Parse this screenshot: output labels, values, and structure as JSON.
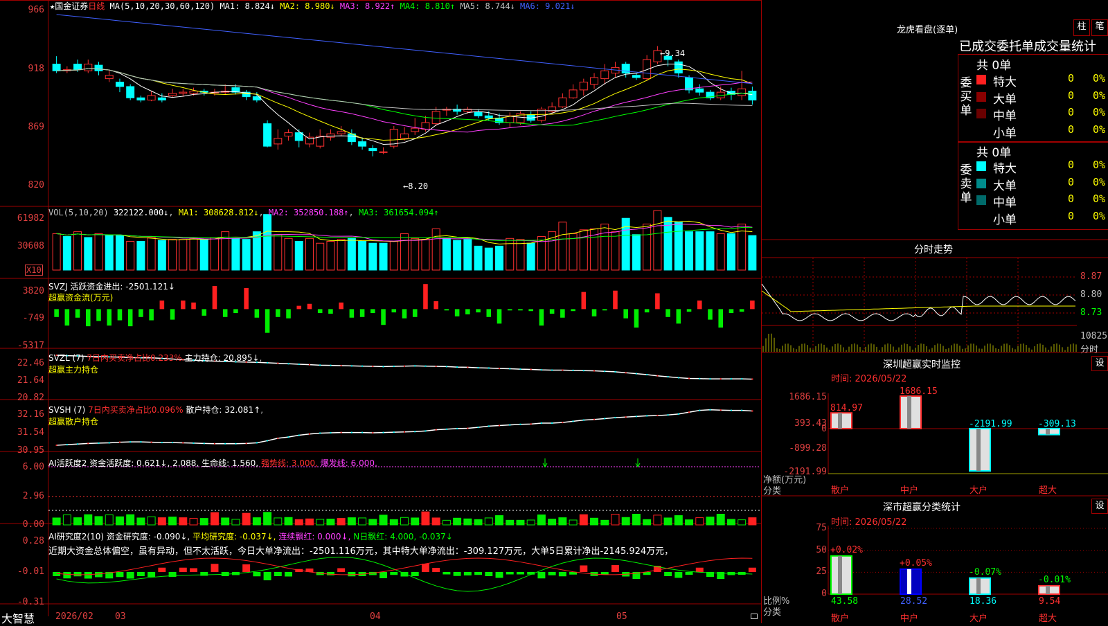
{
  "stock": {
    "star": "★",
    "name": "国金证券",
    "period": "日线",
    "ma_params": "MA(5,10,20,30,60,120)",
    "ma1": "MA1: 8.824↓",
    "ma2": "MA2: 8.980↓",
    "ma3": "MA3: 8.922↑",
    "ma4": "MA4: 8.810↑",
    "ma5": "MA5: 8.744↓",
    "ma6": "MA6: 9.021↓",
    "high_label": "9.34",
    "low_label": "8.20"
  },
  "price_axis": [
    "966",
    "918",
    "869",
    "820"
  ],
  "vol": {
    "params": "VOL(5,10,20)",
    "value": "322122.000↓",
    "ma1": "MA1: 308628.812↓",
    "ma2": "MA2: 352850.188↑",
    "ma3": "MA3: 361654.094↑",
    "axis": [
      "61982",
      "30608"
    ],
    "unit": "X10"
  },
  "svzj": {
    "title": "SVZJ  活跃资金进出: -2501.121↓",
    "subtitle": "超赢资金流(万元)",
    "axis": [
      "3820",
      "-749",
      "-5317"
    ]
  },
  "svzl": {
    "title_a": "SVZL (7)",
    "title_b": "7日内买卖净占比0.233%",
    "title_c": "主力持仓: 20.895↓",
    "subtitle": "超赢主力持仓",
    "axis": [
      "22.46",
      "21.64",
      "20.82"
    ]
  },
  "svsh": {
    "title_a": "SVSH (7)",
    "title_b": "7日内买卖净占比0.096%",
    "title_c": "散户持仓: 32.081↑",
    "subtitle": "超赢散户持仓",
    "axis": [
      "32.16",
      "31.54",
      "30.95"
    ]
  },
  "ai_active": {
    "title_a": "AI活跃度2 资金活跃度: 0.621↓, 2.088, 生命线: 1.560,",
    "title_b": "强势线: 3.000,",
    "title_c": "爆发线: 6.000,",
    "axis": [
      "6.00",
      "2.96",
      "0.00"
    ]
  },
  "ai_research": {
    "title_a": "AI研究度2(10) 资金研究度: -0.090↓,",
    "title_b": "平均研究度: -0.037↓,",
    "title_c": "连续飘红: 0.000↓,",
    "title_d": "N日飘红: 4.000, -0.037↓",
    "comment": "近期大资金总体偏空，虽有异动，但不太活跃，今日大单净流出：-2501.116万元，其中特大单净流出：-309.127万元，大单5日累计净出-2145.924万元，",
    "axis": [
      "0.28",
      "-0.01",
      "-0.31"
    ]
  },
  "xaxis": {
    "brand": "大智慧",
    "labels": [
      "2026/02",
      "03",
      "04",
      "05"
    ]
  },
  "dragon": {
    "title": "龙虎看盘(逐单)",
    "btn_bar": "柱",
    "btn_pen": "笔",
    "header": "已成交委托单成交量统计",
    "buy": {
      "side_label": "委买单",
      "total": "共 0单",
      "rows": [
        {
          "label": "特大",
          "value": "0",
          "pct": "0%"
        },
        {
          "label": "大单",
          "value": "0",
          "pct": "0%"
        },
        {
          "label": "中单",
          "value": "0",
          "pct": "0%"
        },
        {
          "label": "小单",
          "value": "0",
          "pct": "0%"
        }
      ]
    },
    "sell": {
      "side_label": "委卖单",
      "total": "共 0单",
      "rows": [
        {
          "label": "特大",
          "value": "0",
          "pct": "0%"
        },
        {
          "label": "大单",
          "value": "0",
          "pct": "0%"
        },
        {
          "label": "中单",
          "value": "0",
          "pct": "0%"
        },
        {
          "label": "小单",
          "value": "0",
          "pct": "0%"
        }
      ]
    }
  },
  "intraday": {
    "title": "分时走势",
    "axis": [
      "8.87",
      "8.80",
      "8.73"
    ],
    "vol_label": "10825",
    "vol_unit": "分时"
  },
  "sz_monitor": {
    "title": "深圳超赢实时监控",
    "btn": "设",
    "time": "时间: 2026/05/22",
    "axis": [
      "1686.15",
      "393.43",
      "0",
      "-899.28",
      "-2191.99"
    ],
    "ylabel": "净额(万元)",
    "xlabel": "分类",
    "cats": [
      "散户",
      "中户",
      "大户",
      "超大"
    ],
    "values": [
      814.97,
      1686.15,
      -2191.99,
      -309.13
    ],
    "value_labels": [
      "814.97",
      "1686.15",
      "-2191.99",
      "-309.13"
    ]
  },
  "sz_class": {
    "title": "深市超赢分类统计",
    "btn": "设",
    "time": "时间: 2026/05/22",
    "axis": [
      "75",
      "50",
      "25",
      "0"
    ],
    "ylabel": "比例%",
    "xlabel": "分类",
    "cats": [
      "散户",
      "中户",
      "大户",
      "超大"
    ],
    "values": [
      43.58,
      28.52,
      18.36,
      9.54
    ],
    "pct_labels": [
      "+0.02%",
      "+0.05%",
      "-0.07%",
      "-0.01%"
    ],
    "value_labels": [
      "43.58",
      "28.52",
      "18.36",
      "9.54"
    ]
  },
  "colors": {
    "grid": "#a00000",
    "up": "#ff3030",
    "down": "#00ffff",
    "ma1": "#ffffff",
    "ma2": "#ffff00",
    "ma3": "#ff40ff",
    "ma4": "#00ff00",
    "ma5": "#c0c0c0",
    "ma6": "#4060ff"
  },
  "chart_data": [
    {
      "type": "candlestick",
      "title": "国金证券 日线",
      "ylim": [
        8.1,
        9.7
      ],
      "candles": [
        [
          9.18,
          9.12,
          9.25,
          9.1
        ],
        [
          9.12,
          9.13,
          9.16,
          9.1
        ],
        [
          9.18,
          9.13,
          9.22,
          9.11
        ],
        [
          9.12,
          9.18,
          9.22,
          9.1
        ],
        [
          9.17,
          9.12,
          9.2,
          9.08
        ],
        [
          9.05,
          9.08,
          9.12,
          9.02
        ],
        [
          9.02,
          8.98,
          9.05,
          8.93
        ],
        [
          8.98,
          8.88,
          9.0,
          8.86
        ],
        [
          8.88,
          8.86,
          8.9,
          8.84
        ],
        [
          8.86,
          8.9,
          8.94,
          8.85
        ],
        [
          8.88,
          8.86,
          8.92,
          8.84
        ],
        [
          8.9,
          8.92,
          8.96,
          8.88
        ],
        [
          8.92,
          8.93,
          8.96,
          8.89
        ],
        [
          8.92,
          8.94,
          8.97,
          8.9
        ],
        [
          8.94,
          8.93,
          8.96,
          8.9
        ],
        [
          8.93,
          8.93,
          8.96,
          8.9
        ],
        [
          8.93,
          8.94,
          9.0,
          8.91
        ],
        [
          8.97,
          8.93,
          9.0,
          8.91
        ],
        [
          8.93,
          8.89,
          8.95,
          8.86
        ],
        [
          8.89,
          8.86,
          8.93,
          8.84
        ],
        [
          8.65,
          8.45,
          8.68,
          8.44
        ],
        [
          8.47,
          8.52,
          8.6,
          8.42
        ],
        [
          8.54,
          8.57,
          8.6,
          8.5
        ],
        [
          8.57,
          8.5,
          8.6,
          8.44
        ],
        [
          8.47,
          8.53,
          8.57,
          8.44
        ],
        [
          8.45,
          8.54,
          8.6,
          8.43
        ],
        [
          8.53,
          8.56,
          8.6,
          8.5
        ],
        [
          8.56,
          8.58,
          8.63,
          8.54
        ],
        [
          8.56,
          8.49,
          8.6,
          8.46
        ],
        [
          8.49,
          8.45,
          8.52,
          8.42
        ],
        [
          8.43,
          8.41,
          8.46,
          8.36
        ],
        [
          8.4,
          8.4,
          8.44,
          8.38
        ],
        [
          8.45,
          8.6,
          8.63,
          8.43
        ],
        [
          8.52,
          8.56,
          8.62,
          8.5
        ],
        [
          8.58,
          8.61,
          8.7,
          8.55
        ],
        [
          8.6,
          8.66,
          8.72,
          8.58
        ],
        [
          8.65,
          8.76,
          8.8,
          8.63
        ],
        [
          8.77,
          8.78,
          8.8,
          8.72
        ],
        [
          8.78,
          8.76,
          8.82,
          8.73
        ],
        [
          8.76,
          8.78,
          8.8,
          8.74
        ],
        [
          8.75,
          8.72,
          8.78,
          8.7
        ],
        [
          8.72,
          8.7,
          8.76,
          8.68
        ],
        [
          8.7,
          8.66,
          8.74,
          8.64
        ],
        [
          8.66,
          8.72,
          8.75,
          8.62
        ],
        [
          8.66,
          8.74,
          8.76,
          8.64
        ],
        [
          8.73,
          8.68,
          8.76,
          8.66
        ],
        [
          8.68,
          8.78,
          8.8,
          8.66
        ],
        [
          8.76,
          8.8,
          8.84,
          8.74
        ],
        [
          8.8,
          8.88,
          8.92,
          8.79
        ],
        [
          8.88,
          8.95,
          9.0,
          8.87
        ],
        [
          8.95,
          9.02,
          9.05,
          8.9
        ],
        [
          9.0,
          9.06,
          9.1,
          8.96
        ],
        [
          9.05,
          9.12,
          9.18,
          9.0
        ],
        [
          9.1,
          9.15,
          9.2,
          9.06
        ],
        [
          9.18,
          9.1,
          9.2,
          9.06
        ],
        [
          9.08,
          9.06,
          9.1,
          9.04
        ],
        [
          9.05,
          9.22,
          9.26,
          9.03
        ],
        [
          9.2,
          9.3,
          9.34,
          9.18
        ],
        [
          9.25,
          9.22,
          9.28,
          9.16
        ],
        [
          9.2,
          9.1,
          9.22,
          9.06
        ],
        [
          9.06,
          8.95,
          9.08,
          8.92
        ],
        [
          8.96,
          8.93,
          9.0,
          8.9
        ],
        [
          8.93,
          8.88,
          8.95,
          8.86
        ],
        [
          8.88,
          8.93,
          8.98,
          8.86
        ],
        [
          8.94,
          8.91,
          8.97,
          8.86
        ],
        [
          8.9,
          8.96,
          9.12,
          8.86
        ],
        [
          8.94,
          8.86,
          8.98,
          8.82
        ]
      ]
    },
    {
      "type": "bar",
      "title": "VOL",
      "ylim": [
        0,
        65000
      ],
      "values": [
        38000,
        35000,
        40000,
        34000,
        38000,
        36000,
        36000,
        30000,
        30000,
        34000,
        31000,
        32000,
        32000,
        33000,
        32000,
        34000,
        40000,
        33000,
        32000,
        40000,
        58000,
        37000,
        33000,
        30000,
        33000,
        28000,
        30000,
        32000,
        33000,
        30000,
        28000,
        28000,
        30000,
        38000,
        33000,
        32000,
        43000,
        33000,
        31000,
        32000,
        25000,
        23000,
        25000,
        33000,
        32000,
        28000,
        35000,
        40000,
        50000,
        38000,
        42000,
        43000,
        48000,
        40000,
        54000,
        37000,
        48000,
        62000,
        55000,
        50000,
        40000,
        40000,
        40000,
        38000,
        38000,
        48000,
        36000
      ],
      "up_flags": [
        1,
        0,
        1,
        0,
        1,
        0,
        0,
        1,
        0,
        1,
        0,
        1,
        1,
        1,
        0,
        1,
        1,
        0,
        0,
        0,
        0,
        1,
        1,
        0,
        1,
        1,
        1,
        1,
        0,
        0,
        0,
        0,
        1,
        1,
        1,
        1,
        1,
        0,
        0,
        0,
        0,
        0,
        0,
        1,
        1,
        0,
        1,
        1,
        1,
        1,
        1,
        1,
        1,
        1,
        0,
        0,
        1,
        1,
        0,
        0,
        0,
        0,
        0,
        1,
        0,
        1,
        0
      ]
    },
    {
      "type": "bar",
      "title": "SVZJ",
      "ylim": [
        -5317,
        3820
      ],
      "values": [
        -1200,
        -2500,
        -1300,
        -2600,
        -1800,
        -2500,
        -1700,
        -2600,
        -1200,
        -1700,
        1300,
        -1600,
        1300,
        1000,
        -1000,
        3500,
        -1200,
        -600,
        3200,
        -1300,
        -3600,
        -1200,
        -1400,
        500,
        800,
        -600,
        -700,
        1000,
        -1300,
        -1200,
        -600,
        -2400,
        -500,
        -1400,
        -1200,
        3800,
        1200,
        -200,
        -1100,
        -800,
        -500,
        -1200,
        -2200,
        -200,
        -200,
        -300,
        -2500,
        -700,
        -1300,
        -300,
        2600,
        -1100,
        -200,
        2800,
        -1400,
        -2800,
        -500,
        2400,
        -1200,
        -2200,
        -400,
        1300,
        -1600,
        -2800,
        -600,
        -400,
        1300
      ]
    },
    {
      "type": "line",
      "title": "SVZL",
      "ylim": [
        20.82,
        22.46
      ],
      "values": [
        22.46,
        22.44,
        22.43,
        22.41,
        22.4,
        22.39,
        22.38,
        22.36,
        22.35,
        22.35,
        22.33,
        22.3,
        22.27,
        22.25,
        22.23,
        22.21,
        22.2,
        22.18,
        22.17,
        22.16,
        22.14,
        22.12,
        22.1,
        22.08,
        22.06,
        22.04,
        22.03,
        22.02,
        22.01,
        22.0,
        21.99,
        21.98,
        21.99,
        22.0,
        22.01,
        22.0,
        21.99,
        21.98,
        21.96,
        21.95,
        21.93,
        21.92,
        21.9,
        21.89,
        21.87,
        21.86,
        21.84,
        21.83,
        21.83,
        21.82,
        21.81,
        21.8,
        21.78,
        21.76,
        21.72,
        21.68,
        21.64,
        21.59,
        21.55,
        21.51,
        21.48,
        21.47,
        21.46,
        21.46,
        21.46,
        21.46,
        21.45
      ]
    },
    {
      "type": "line",
      "title": "SVSH",
      "ylim": [
        30.95,
        32.16
      ],
      "values": [
        30.95,
        30.97,
        30.99,
        31.01,
        31.02,
        31.03,
        31.05,
        31.06,
        31.06,
        31.05,
        31.04,
        31.04,
        31.03,
        31.02,
        31.01,
        31.0,
        31.0,
        31.0,
        31.01,
        31.03,
        31.1,
        31.18,
        31.22,
        31.28,
        31.32,
        31.35,
        31.36,
        31.37,
        31.37,
        31.37,
        31.36,
        31.37,
        31.38,
        31.39,
        31.4,
        31.42,
        31.46,
        31.48,
        31.5,
        31.51,
        31.54,
        31.58,
        31.6,
        31.62,
        31.64,
        31.65,
        31.68,
        31.68,
        31.7,
        31.74,
        31.78,
        31.8,
        31.83,
        31.86,
        31.88,
        31.9,
        31.92,
        31.93,
        31.95,
        31.98,
        32.04,
        32.1,
        32.12,
        32.11,
        32.1,
        32.1,
        32.08
      ]
    }
  ]
}
